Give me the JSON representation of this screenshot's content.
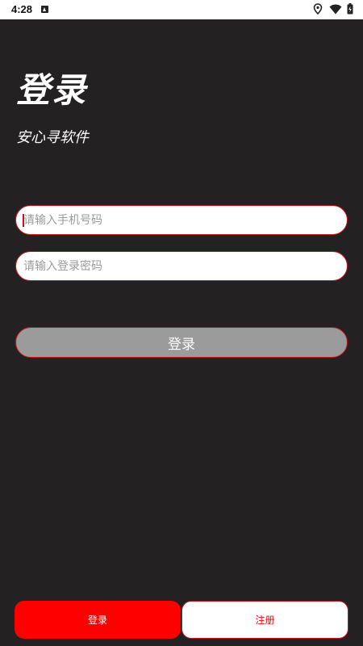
{
  "status_bar": {
    "time": "4:28",
    "icons": [
      "notification-app-icon",
      "location-icon",
      "wifi-icon",
      "battery-icon"
    ]
  },
  "header": {
    "title": "登录",
    "subtitle": "安心寻软件"
  },
  "form": {
    "phone_placeholder": "请输入手机号码",
    "password_placeholder": "请输入登录密码",
    "login_label": "登录"
  },
  "tabs": [
    {
      "label": "登录",
      "selected": true
    },
    {
      "label": "注册",
      "selected": false
    }
  ],
  "colors": {
    "background": "#232122",
    "accent": "#ff0000",
    "border": "#c4161c",
    "button_disabled": "#9b9b9b"
  }
}
